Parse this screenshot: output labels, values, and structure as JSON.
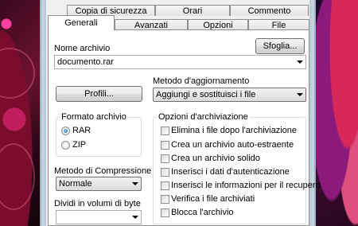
{
  "tabs_row1": [
    "Copia di sicurezza",
    "Orari",
    "Commento"
  ],
  "tabs_row2": [
    "Generali",
    "Avanzati",
    "Opzioni",
    "File"
  ],
  "archive_name": {
    "label": "Nome archivio",
    "browse_label": "Sfoglia...",
    "value": "documento.rar"
  },
  "profiles_label": "Profili...",
  "update_method": {
    "label": "Metodo d'aggiornamento",
    "value": "Aggiungi e sostituisci i file"
  },
  "archive_format": {
    "title": "Formato archivio",
    "options": [
      "RAR",
      "ZIP"
    ],
    "selected": "RAR"
  },
  "compression": {
    "label": "Metodo di Compressione",
    "value": "Normale"
  },
  "split": {
    "label": "Dividi in volumi di byte",
    "value": ""
  },
  "archive_options": {
    "title": "Opzioni d'archiviazione",
    "items": [
      "Elimina i file dopo l'archiviazione",
      "Crea un archivio auto-estraente",
      "Crea un archivio solido",
      "Inserisci i dati d'autenticazione",
      "Inserisci le informazioni per il recupero",
      "Verifica i file archiviati",
      "Blocca l'archivio"
    ],
    "checked": [
      false,
      false,
      false,
      false,
      false,
      false,
      false
    ]
  }
}
